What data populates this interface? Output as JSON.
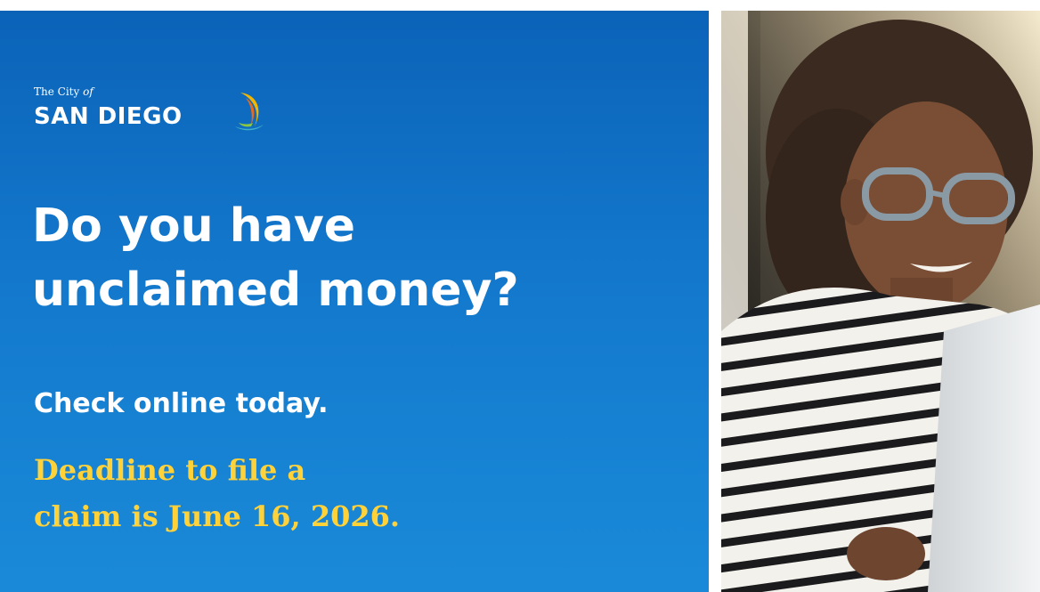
{
  "logo": {
    "line1_prefix": "The City",
    "line1_of": "of",
    "line2": "SAN DIEGO"
  },
  "headline": {
    "line1": "Do you have",
    "line2": "unclaimed money?"
  },
  "subhead": "Check online today.",
  "deadline": {
    "line1": "Deadline to file a",
    "line2": "claim is June 16, 2026."
  },
  "colors": {
    "panel_blue": "#1378cc",
    "deadline_yellow": "#ffd23a",
    "white": "#ffffff"
  }
}
